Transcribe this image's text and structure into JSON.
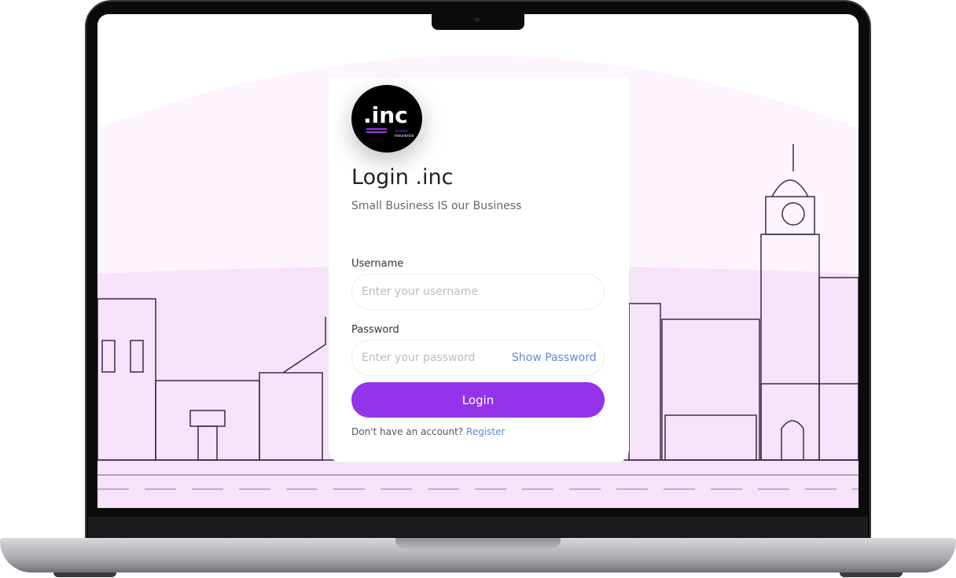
{
  "logo": {
    "main": ".inc",
    "tag1": "knows",
    "tag2": "insurance"
  },
  "login": {
    "title": "Login .inc",
    "subtitle": "Small Business IS our Business",
    "username_label": "Username",
    "username_placeholder": "Enter your username",
    "password_label": "Password",
    "password_placeholder": "Enter your password",
    "show_password": "Show Password",
    "submit": "Login",
    "register_prompt": "Don't have an account?",
    "register_link": "Register"
  },
  "colors": {
    "accent": "#9333ea",
    "link": "#5b8ad8",
    "background_tint": "#fbeefd",
    "outline": "#3b2a4a"
  }
}
